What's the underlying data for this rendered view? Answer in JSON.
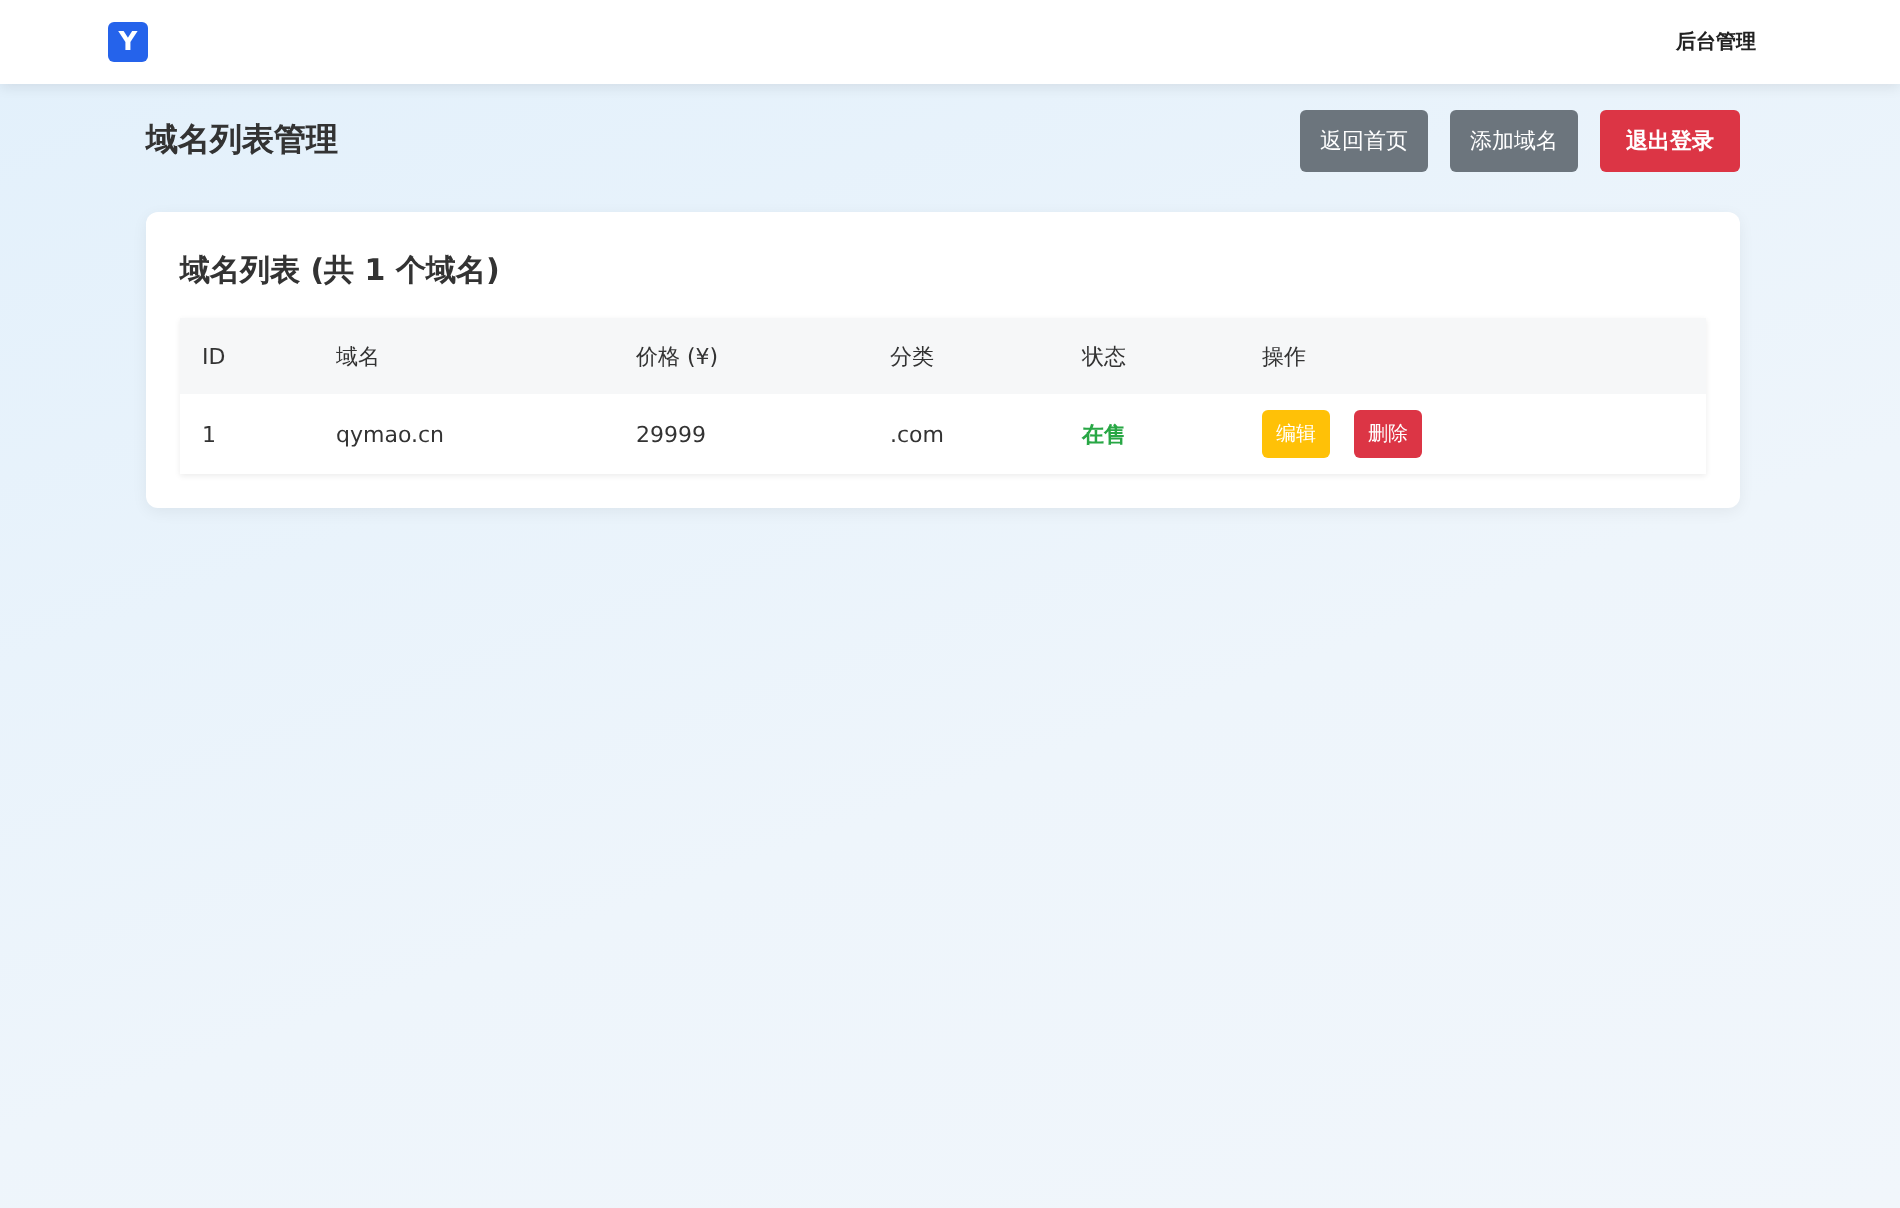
{
  "navbar": {
    "logo": "Y",
    "link": "后台管理"
  },
  "page_title": "域名列表管理",
  "header_buttons": [
    {
      "label": "返回首页",
      "kind": "secondary"
    },
    {
      "label": "添加域名",
      "kind": "secondary"
    },
    {
      "label": "退出登录",
      "kind": "danger"
    }
  ],
  "card": {
    "title": "域名列表 (共 1 个域名)",
    "table": {
      "columns": [
        "ID",
        "域名",
        "价格 (¥)",
        "分类",
        "状态",
        "操作"
      ],
      "rows": [
        {
          "id": "1",
          "domain": "qymao.cn",
          "price": "29999",
          "category": ".com",
          "status": "在售",
          "on_sale": true,
          "actions": [
            {
              "label": "编辑",
              "kind": "warning"
            },
            {
              "label": "删除",
              "kind": "danger"
            }
          ]
        }
      ]
    }
  }
}
